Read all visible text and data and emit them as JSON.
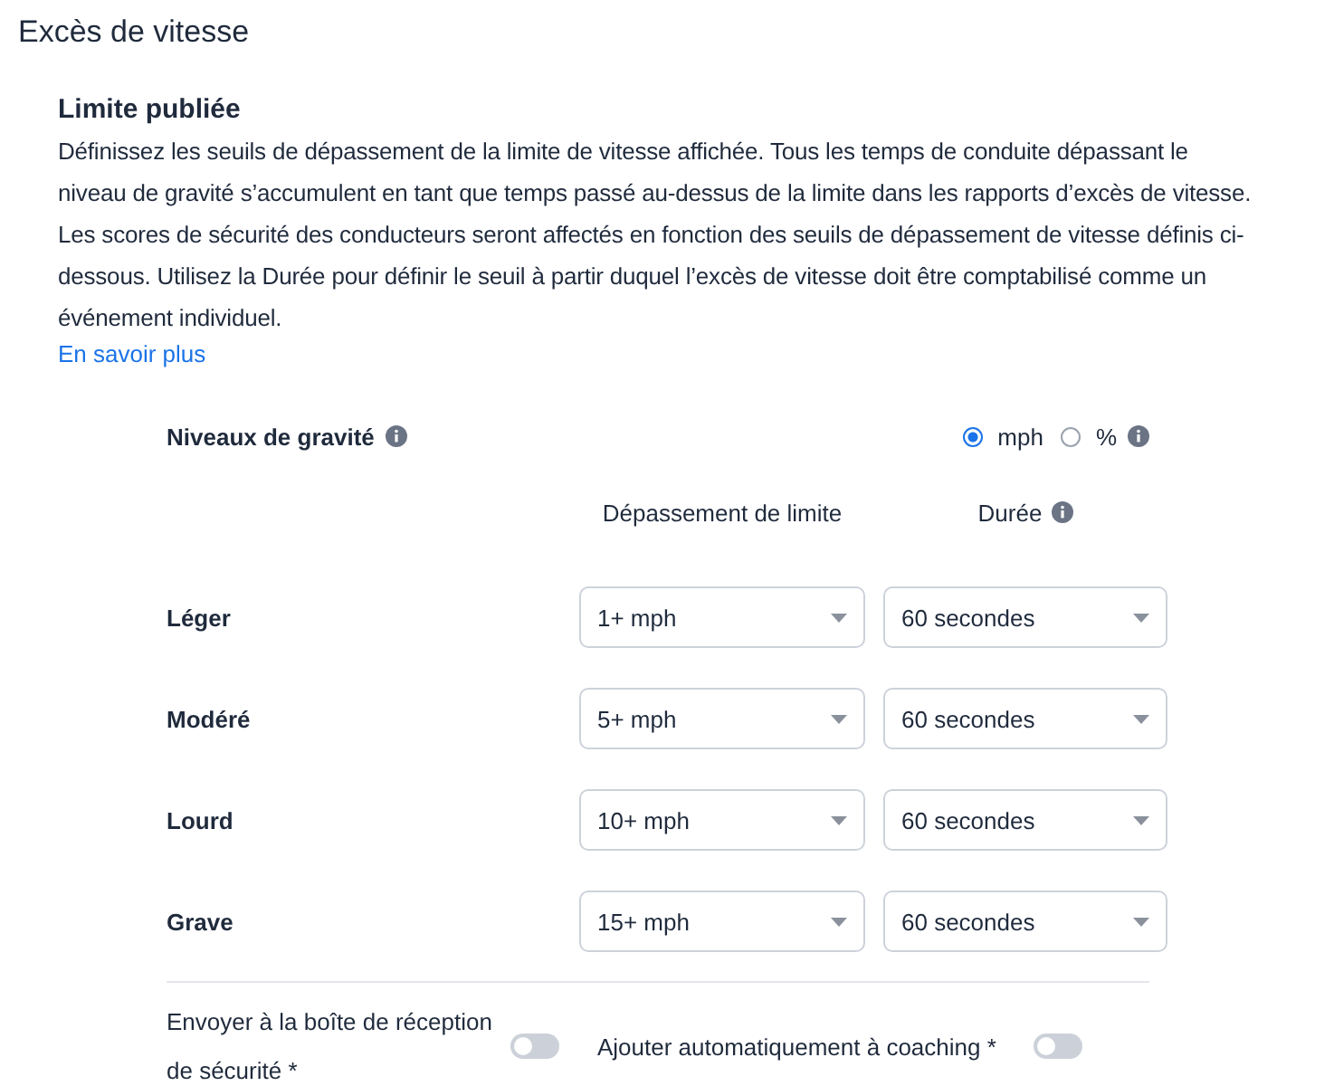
{
  "page_title": "Excès de vitesse",
  "section": {
    "title": "Limite publiée",
    "description": "Définissez les seuils de dépassement de la limite de vitesse affichée. Tous les temps de conduite dépassant le niveau de gravité s’accumulent en tant que temps passé au-dessus de la limite dans les rapports d’excès de vitesse. Les scores de sécurité des conducteurs seront affectés en fonction des seuils de dépassement de vitesse définis ci-dessous. Utilisez la Durée pour définir le seuil à partir duquel l’excès de vitesse doit être comptabilisé comme un événement individuel.",
    "link": "En savoir plus"
  },
  "severity": {
    "label": "Niveaux de gravité",
    "units": [
      {
        "label": "mph",
        "selected": true
      },
      {
        "label": "%",
        "selected": false
      }
    ],
    "columns": [
      "Dépassement de limite",
      "Durée"
    ],
    "rows": [
      {
        "level": "Léger",
        "threshold": "1+ mph",
        "duration": "60 secondes"
      },
      {
        "level": "Modéré",
        "threshold": "5+ mph",
        "duration": "60 secondes"
      },
      {
        "level": "Lourd",
        "threshold": "10+ mph",
        "duration": "60 secondes"
      },
      {
        "level": "Grave",
        "threshold": "15+ mph",
        "duration": "60 secondes"
      }
    ]
  },
  "toggles": [
    {
      "label": "Envoyer à la boîte de réception de sécurité *",
      "on": false
    },
    {
      "label": "Ajouter automatiquement à coaching *",
      "on": false
    }
  ]
}
